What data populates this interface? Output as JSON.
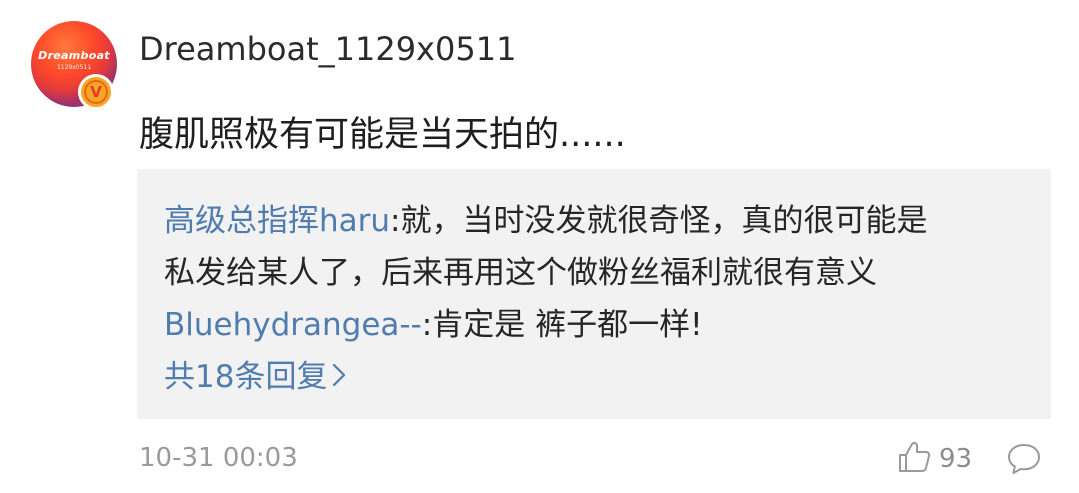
{
  "author": {
    "avatar_text": "Dreamboat",
    "avatar_subtext": "1129x0511",
    "verified_badge": "V",
    "username": "Dreamboat_1129x0511"
  },
  "comment": {
    "text": "腹肌照极有可能是当天拍的......"
  },
  "replies": [
    {
      "user": "高级总指挥haru",
      "text_line1": ":就，当时没发就很奇怪，真的很可能是",
      "text_line2": "私发给某人了，后来再用这个做粉丝福利就很有意义"
    },
    {
      "user": "Bluehydrangea--",
      "text_line1": ":肯定是 裤子都一样!"
    }
  ],
  "more_replies_label": "共18条回复",
  "footer": {
    "timestamp": "10-31 00:03",
    "like_count": "93",
    "icons": [
      "thumbs-up-icon",
      "comment-bubble-icon"
    ]
  },
  "colors": {
    "link": "#507daf",
    "reply_bg": "#f2f2f2",
    "muted": "#9a9a9a"
  }
}
